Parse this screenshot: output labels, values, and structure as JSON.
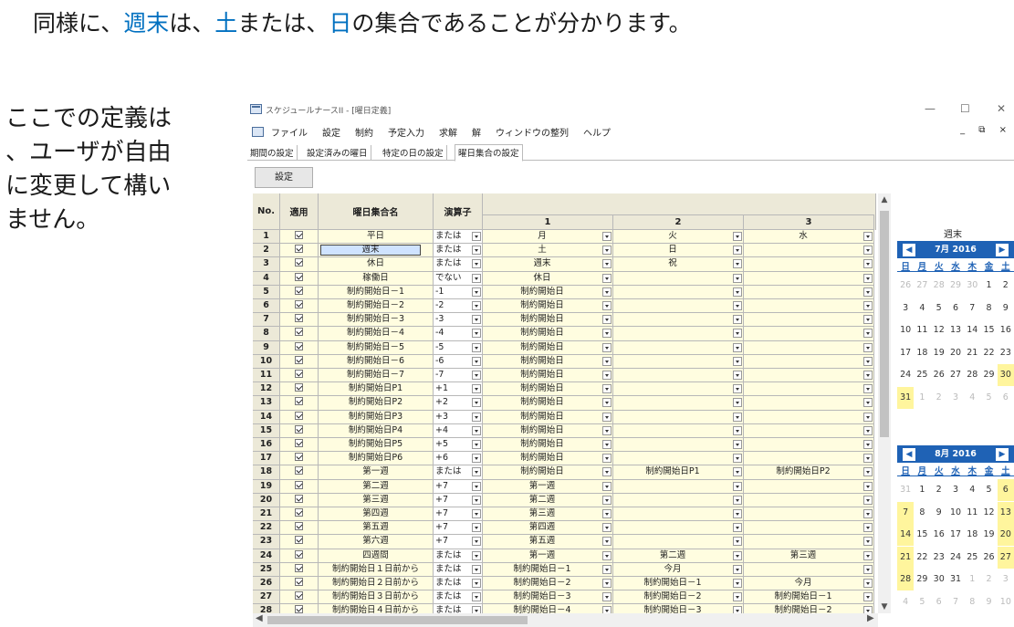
{
  "slide": {
    "title_parts": [
      "同様に、",
      "週末",
      "は、",
      "土",
      "または、",
      "日",
      "の集合であることが分かります。"
    ],
    "note_lines": [
      "ここでの定義は",
      "、ユーザが自由",
      "に変更して構い",
      "ません。"
    ]
  },
  "window": {
    "title": "スケジュールナースII - [曜日定義]",
    "controls": [
      "—",
      "☐",
      "✕"
    ]
  },
  "menu": {
    "items": [
      "ファイル",
      "設定",
      "制約",
      "予定入力",
      "求解",
      "解",
      "ウィンドウの整列",
      "ヘルプ"
    ],
    "mdi_controls": "_ ⧉ ×"
  },
  "tabs": [
    "期間の設定",
    "設定済みの曜日",
    "特定の日の設定",
    "曜日集合の設定"
  ],
  "active_tab": 3,
  "set_button": "設定",
  "grid": {
    "headers": {
      "no": "No.",
      "apply": "適用",
      "name": "曜日集合名",
      "op": "演算子",
      "c1": "1",
      "c2": "2",
      "c3": "3"
    },
    "rows": [
      {
        "no": "1",
        "name": "平日",
        "op": "または",
        "c1": "月",
        "c2": "火",
        "c3": "水"
      },
      {
        "no": "2",
        "name": "週末",
        "op": "または",
        "c1": "土",
        "c2": "日",
        "c3": ""
      },
      {
        "no": "3",
        "name": "休日",
        "op": "または",
        "c1": "週末",
        "c2": "祝",
        "c3": ""
      },
      {
        "no": "4",
        "name": "稼働日",
        "op": "でない",
        "c1": "休日",
        "c2": "",
        "c3": ""
      },
      {
        "no": "5",
        "name": "制約開始日－1",
        "op": "-1",
        "c1": "制約開始日",
        "c2": "",
        "c3": ""
      },
      {
        "no": "6",
        "name": "制約開始日－2",
        "op": "-2",
        "c1": "制約開始日",
        "c2": "",
        "c3": ""
      },
      {
        "no": "7",
        "name": "制約開始日－3",
        "op": "-3",
        "c1": "制約開始日",
        "c2": "",
        "c3": ""
      },
      {
        "no": "8",
        "name": "制約開始日－4",
        "op": "-4",
        "c1": "制約開始日",
        "c2": "",
        "c3": ""
      },
      {
        "no": "9",
        "name": "制約開始日－5",
        "op": "-5",
        "c1": "制約開始日",
        "c2": "",
        "c3": ""
      },
      {
        "no": "10",
        "name": "制約開始日－6",
        "op": "-6",
        "c1": "制約開始日",
        "c2": "",
        "c3": ""
      },
      {
        "no": "11",
        "name": "制約開始日－7",
        "op": "-7",
        "c1": "制約開始日",
        "c2": "",
        "c3": ""
      },
      {
        "no": "12",
        "name": "制約開始日P1",
        "op": "+1",
        "c1": "制約開始日",
        "c2": "",
        "c3": ""
      },
      {
        "no": "13",
        "name": "制約開始日P2",
        "op": "+2",
        "c1": "制約開始日",
        "c2": "",
        "c3": ""
      },
      {
        "no": "14",
        "name": "制約開始日P3",
        "op": "+3",
        "c1": "制約開始日",
        "c2": "",
        "c3": ""
      },
      {
        "no": "15",
        "name": "制約開始日P4",
        "op": "+4",
        "c1": "制約開始日",
        "c2": "",
        "c3": ""
      },
      {
        "no": "16",
        "name": "制約開始日P5",
        "op": "+5",
        "c1": "制約開始日",
        "c2": "",
        "c3": ""
      },
      {
        "no": "17",
        "name": "制約開始日P6",
        "op": "+6",
        "c1": "制約開始日",
        "c2": "",
        "c3": ""
      },
      {
        "no": "18",
        "name": "第一週",
        "op": "または",
        "c1": "制約開始日",
        "c2": "制約開始日P1",
        "c3": "制約開始日P2"
      },
      {
        "no": "19",
        "name": "第二週",
        "op": "+7",
        "c1": "第一週",
        "c2": "",
        "c3": ""
      },
      {
        "no": "20",
        "name": "第三週",
        "op": "+7",
        "c1": "第二週",
        "c2": "",
        "c3": ""
      },
      {
        "no": "21",
        "name": "第四週",
        "op": "+7",
        "c1": "第三週",
        "c2": "",
        "c3": ""
      },
      {
        "no": "22",
        "name": "第五週",
        "op": "+7",
        "c1": "第四週",
        "c2": "",
        "c3": ""
      },
      {
        "no": "23",
        "name": "第六週",
        "op": "+7",
        "c1": "第五週",
        "c2": "",
        "c3": ""
      },
      {
        "no": "24",
        "name": "四週間",
        "op": "または",
        "c1": "第一週",
        "c2": "第二週",
        "c3": "第三週"
      },
      {
        "no": "25",
        "name": "制約開始日１日前から",
        "op": "または",
        "c1": "制約開始日－1",
        "c2": "今月",
        "c3": ""
      },
      {
        "no": "26",
        "name": "制約開始日２日前から",
        "op": "または",
        "c1": "制約開始日－2",
        "c2": "制約開始日－1",
        "c3": "今月"
      },
      {
        "no": "27",
        "name": "制約開始日３日前から",
        "op": "または",
        "c1": "制約開始日－3",
        "c2": "制約開始日－2",
        "c3": "制約開始日－1"
      },
      {
        "no": "28",
        "name": "制約開始日４日前から",
        "op": "または",
        "c1": "制約開始日－4",
        "c2": "制約開始日－3",
        "c3": "制約開始日－2"
      }
    ],
    "selected_row": 1
  },
  "calendar_label": "週末",
  "calendars": [
    {
      "month": "7月 2016",
      "dow": [
        "日",
        "月",
        "火",
        "水",
        "木",
        "金",
        "土"
      ],
      "weeks": [
        [
          {
            "d": "26",
            "o": true
          },
          {
            "d": "27",
            "o": true
          },
          {
            "d": "28",
            "o": true
          },
          {
            "d": "29",
            "o": true
          },
          {
            "d": "30",
            "o": true
          },
          {
            "d": "1"
          },
          {
            "d": "2"
          }
        ],
        [
          {
            "d": "3"
          },
          {
            "d": "4"
          },
          {
            "d": "5"
          },
          {
            "d": "6"
          },
          {
            "d": "7"
          },
          {
            "d": "8"
          },
          {
            "d": "9"
          }
        ],
        [
          {
            "d": "10"
          },
          {
            "d": "11"
          },
          {
            "d": "12"
          },
          {
            "d": "13"
          },
          {
            "d": "14"
          },
          {
            "d": "15"
          },
          {
            "d": "16"
          }
        ],
        [
          {
            "d": "17"
          },
          {
            "d": "18"
          },
          {
            "d": "19"
          },
          {
            "d": "20"
          },
          {
            "d": "21"
          },
          {
            "d": "22"
          },
          {
            "d": "23"
          }
        ],
        [
          {
            "d": "24"
          },
          {
            "d": "25"
          },
          {
            "d": "26"
          },
          {
            "d": "27"
          },
          {
            "d": "28"
          },
          {
            "d": "29"
          },
          {
            "d": "30",
            "h": true
          }
        ],
        [
          {
            "d": "31",
            "h": true
          },
          {
            "d": "1",
            "o": true
          },
          {
            "d": "2",
            "o": true
          },
          {
            "d": "3",
            "o": true
          },
          {
            "d": "4",
            "o": true
          },
          {
            "d": "5",
            "o": true
          },
          {
            "d": "6",
            "o": true
          }
        ]
      ]
    },
    {
      "month": "8月 2016",
      "dow": [
        "日",
        "月",
        "火",
        "水",
        "木",
        "金",
        "土"
      ],
      "weeks": [
        [
          {
            "d": "31",
            "o": true
          },
          {
            "d": "1"
          },
          {
            "d": "2"
          },
          {
            "d": "3"
          },
          {
            "d": "4"
          },
          {
            "d": "5"
          },
          {
            "d": "6",
            "h": true
          }
        ],
        [
          {
            "d": "7",
            "h": true
          },
          {
            "d": "8"
          },
          {
            "d": "9"
          },
          {
            "d": "10"
          },
          {
            "d": "11"
          },
          {
            "d": "12"
          },
          {
            "d": "13",
            "h": true
          }
        ],
        [
          {
            "d": "14",
            "h": true
          },
          {
            "d": "15"
          },
          {
            "d": "16"
          },
          {
            "d": "17"
          },
          {
            "d": "18"
          },
          {
            "d": "19"
          },
          {
            "d": "20",
            "h": true
          }
        ],
        [
          {
            "d": "21",
            "h": true
          },
          {
            "d": "22"
          },
          {
            "d": "23"
          },
          {
            "d": "24"
          },
          {
            "d": "25"
          },
          {
            "d": "26"
          },
          {
            "d": "27",
            "h": true
          }
        ],
        [
          {
            "d": "28",
            "h": true
          },
          {
            "d": "29"
          },
          {
            "d": "30"
          },
          {
            "d": "31"
          },
          {
            "d": "1",
            "o": true
          },
          {
            "d": "2",
            "o": true
          },
          {
            "d": "3",
            "o": true
          }
        ],
        [
          {
            "d": "4",
            "o": true
          },
          {
            "d": "5",
            "o": true
          },
          {
            "d": "6",
            "o": true
          },
          {
            "d": "7",
            "o": true
          },
          {
            "d": "8",
            "o": true
          },
          {
            "d": "9",
            "o": true
          },
          {
            "d": "10",
            "o": true
          }
        ]
      ]
    }
  ]
}
